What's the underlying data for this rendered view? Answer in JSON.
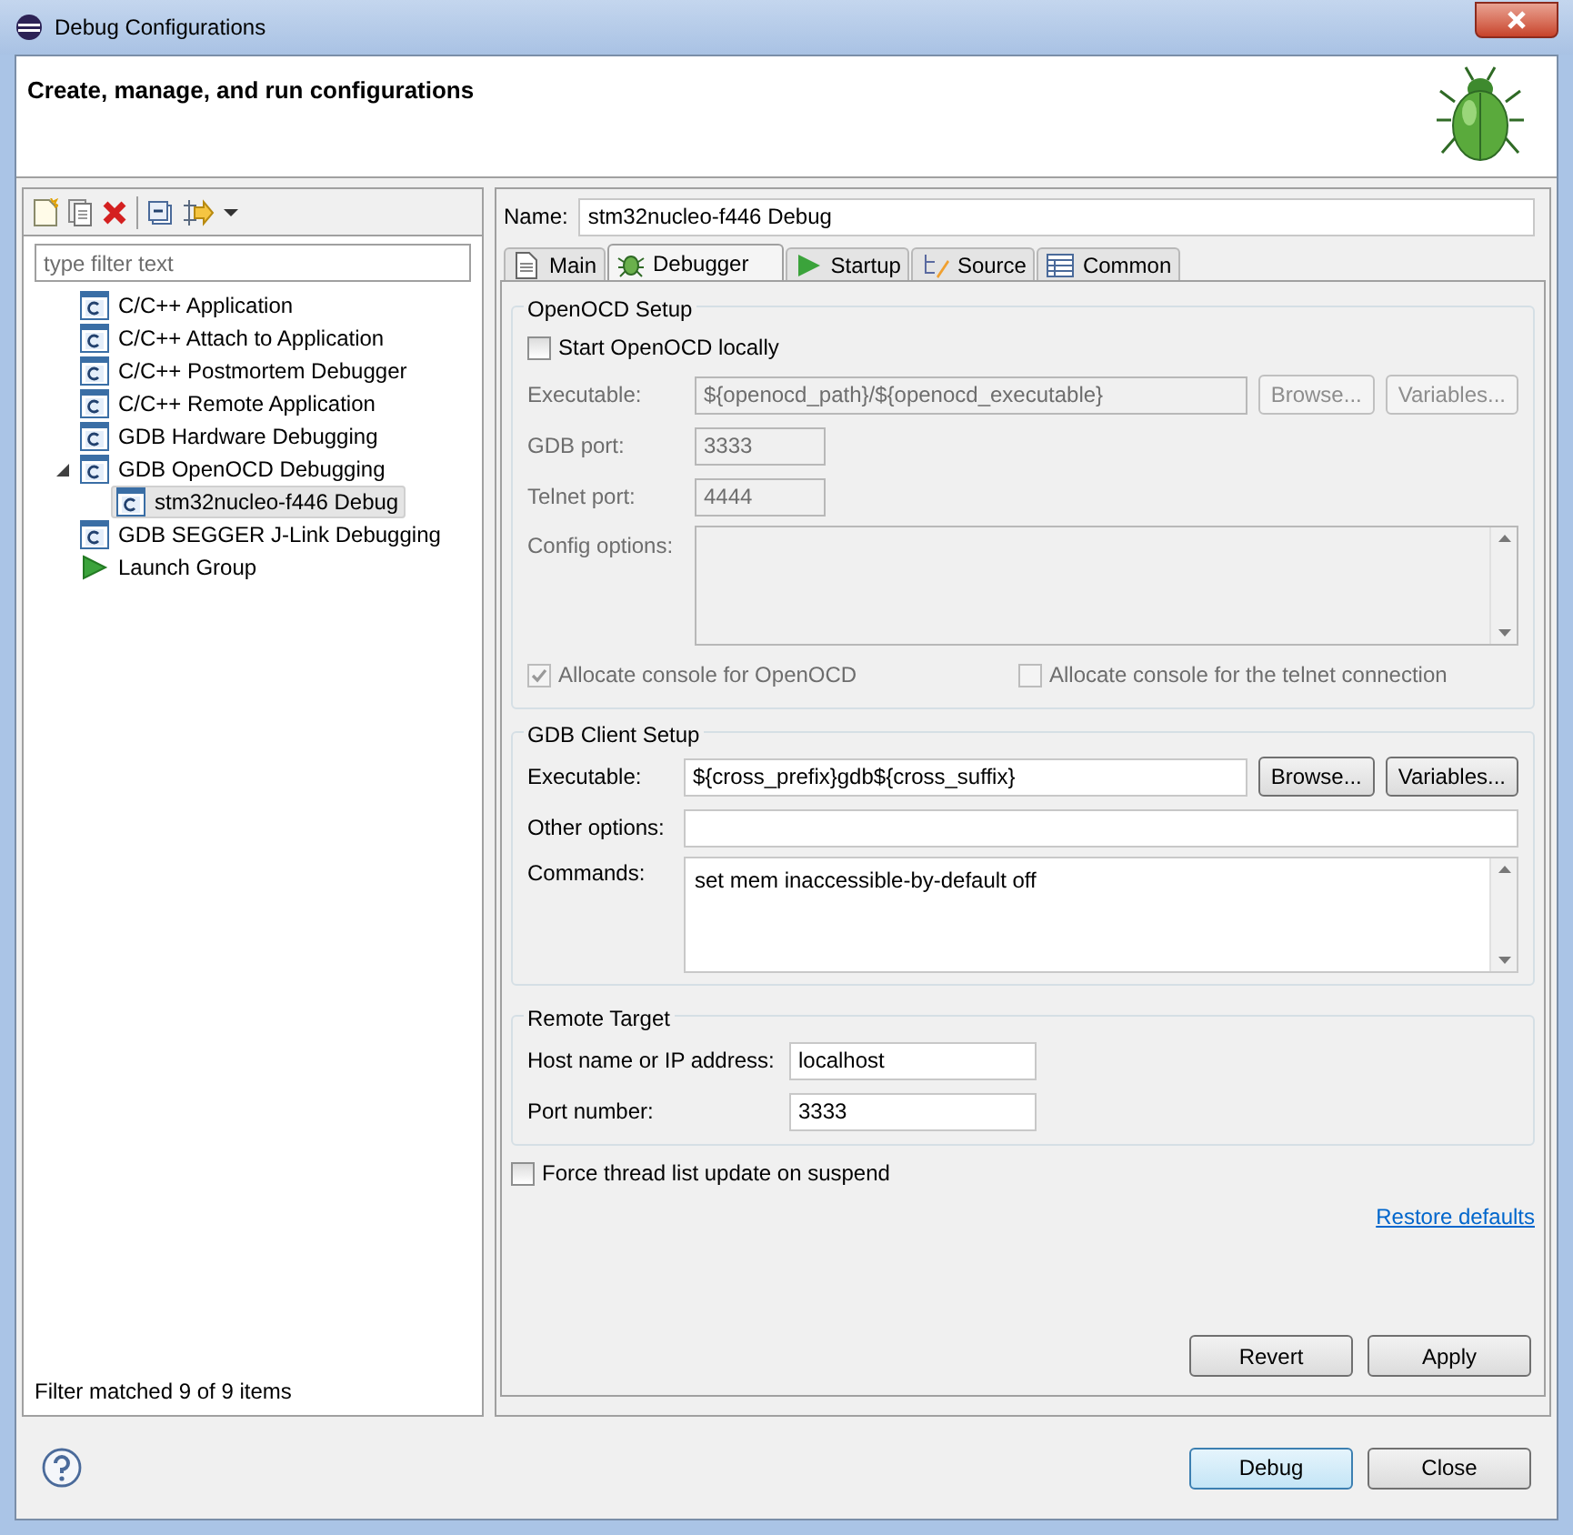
{
  "window": {
    "title": "Debug Configurations"
  },
  "header": {
    "title": "Create, manage, and run configurations"
  },
  "sidebar": {
    "filter": {
      "placeholder": "type filter text"
    },
    "tree": [
      {
        "label": "C/C++ Application",
        "kind": "type"
      },
      {
        "label": "C/C++ Attach to Application",
        "kind": "type"
      },
      {
        "label": "C/C++ Postmortem Debugger",
        "kind": "type"
      },
      {
        "label": "C/C++ Remote Application",
        "kind": "type"
      },
      {
        "label": "GDB Hardware Debugging",
        "kind": "type"
      },
      {
        "label": "GDB OpenOCD Debugging",
        "kind": "type",
        "expanded": true,
        "children": [
          {
            "label": "stm32nucleo-f446 Debug",
            "kind": "type",
            "selected": true
          }
        ]
      },
      {
        "label": "GDB SEGGER J-Link Debugging",
        "kind": "type"
      },
      {
        "label": "Launch Group",
        "kind": "group"
      }
    ],
    "status": "Filter matched 9 of 9 items"
  },
  "name_field": {
    "label": "Name:",
    "value": "stm32nucleo-f446 Debug"
  },
  "tabs": [
    {
      "label": "Main",
      "selected": false
    },
    {
      "label": "Debugger",
      "selected": true
    },
    {
      "label": "Startup",
      "selected": false
    },
    {
      "label": "Source",
      "selected": false
    },
    {
      "label": "Common",
      "selected": false
    }
  ],
  "openocd_setup": {
    "title": "OpenOCD Setup",
    "start_locally": {
      "label": "Start OpenOCD locally",
      "checked": false
    },
    "executable": {
      "label": "Executable:",
      "value": "${openocd_path}/${openocd_executable}",
      "disabled": true
    },
    "browse_button": {
      "label": "Browse...",
      "disabled": true
    },
    "variables_button": {
      "label": "Variables...",
      "disabled": true
    },
    "gdb_port": {
      "label": "GDB port:",
      "value": "3333",
      "disabled": true
    },
    "telnet_port": {
      "label": "Telnet port:",
      "value": "4444",
      "disabled": true
    },
    "config_options": {
      "label": "Config options:",
      "disabled": true
    },
    "allocate_console": {
      "label": "Allocate console for OpenOCD",
      "checked": true,
      "disabled": true
    },
    "allocate_telnet_console": {
      "label": "Allocate console for the telnet connection",
      "checked": false,
      "disabled": true
    }
  },
  "gdb_client_setup": {
    "title": "GDB Client Setup",
    "executable": {
      "label": "Executable:",
      "value": "${cross_prefix}gdb${cross_suffix}"
    },
    "browse_button": {
      "label": "Browse..."
    },
    "variables_button": {
      "label": "Variables..."
    },
    "other_options": {
      "label": "Other options:"
    },
    "commands": {
      "label": "Commands:",
      "value": "set mem inaccessible-by-default off"
    }
  },
  "remote_target": {
    "title": "Remote Target",
    "host": {
      "label": "Host name or IP address:",
      "value": "localhost"
    },
    "port": {
      "label": "Port number:",
      "value": "3333"
    }
  },
  "force_thread_update": {
    "label": "Force thread list update on suspend",
    "checked": false
  },
  "restore_defaults": "Restore defaults",
  "panel_buttons": [
    "Revert",
    "Apply"
  ],
  "dialog_buttons": [
    {
      "label": "Debug",
      "default": true
    },
    {
      "label": "Close",
      "default": false
    }
  ]
}
